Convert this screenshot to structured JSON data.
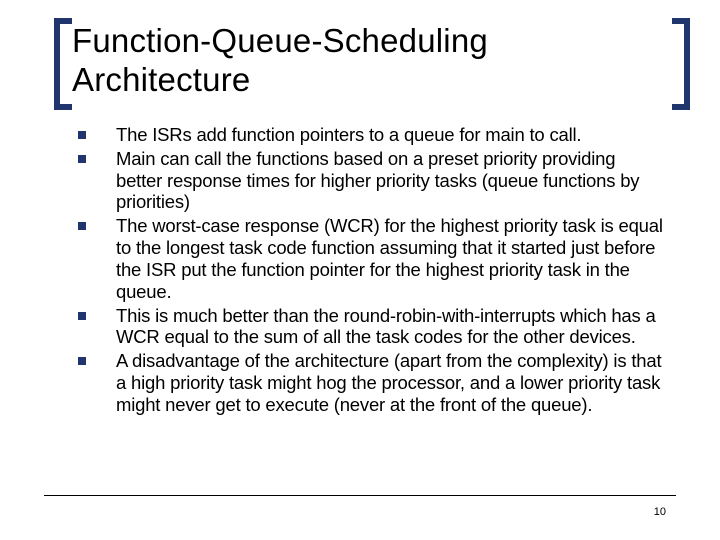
{
  "title": "Function-Queue-Scheduling Architecture",
  "bullets": [
    "The ISRs add function pointers to a queue for main to call.",
    "Main can call the functions based on a preset priority providing better response times for higher priority tasks (queue functions by priorities)",
    "The worst-case response (WCR) for the highest priority task is equal to the longest task code function assuming that it started just before the ISR put the function pointer for the highest priority task in the queue.",
    "This is much better than the round-robin-with-interrupts which has a WCR equal to the sum of all the task codes for the other devices.",
    "A disadvantage of the architecture (apart from the complexity) is that a high priority task might hog the processor, and a lower priority task might never get to execute (never at the front of the queue)."
  ],
  "page_number": "10"
}
